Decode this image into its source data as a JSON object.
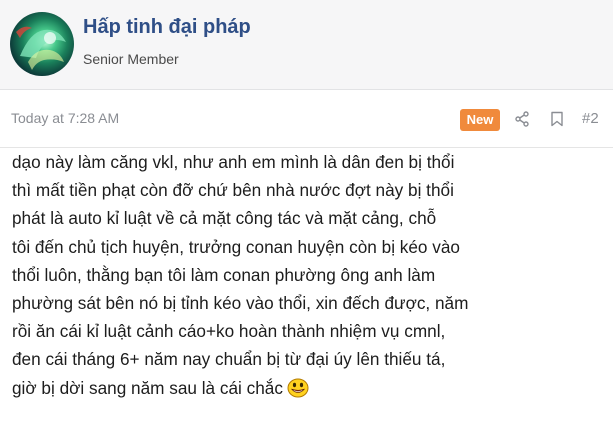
{
  "user": {
    "name": "Hấp tinh đại pháp",
    "title": "Senior Member"
  },
  "post": {
    "time": "Today at 7:28 AM",
    "badge": "New",
    "number": "#2",
    "body": "dạo này làm căng vkl, như anh em mình là dân đen bị thổi\nthì mất tiền phạt còn đỡ chứ bên nhà nước đợt này bị thổi\nphát là auto kỉ luật về cả mặt công tác và mặt cảng, chỗ\ntôi đến chủ tịch huyện, trưởng conan huyện còn bị kéo vào\nthổi luôn, thằng bạn tôi làm conan phường ông anh làm\nphường sát bên nó bị tỉnh kéo vào thổi, xin đếch được, năm\nrồi ăn cái kỉ luật cảnh cáo+ko hoàn thành nhiệm vụ cmnl,\nđen cái tháng 6+ năm nay chuẩn bị từ đại úy lên thiếu tá,\ngiờ bị dời sang năm sau là cái chắc",
    "emoji": "smile-emoji"
  },
  "colors": {
    "username": "#2f4f87",
    "badge": "#f08a3c",
    "meta": "#8a8d93",
    "header_bg": "#f6f6f7"
  },
  "icons": [
    "share-icon",
    "bookmark-icon"
  ]
}
